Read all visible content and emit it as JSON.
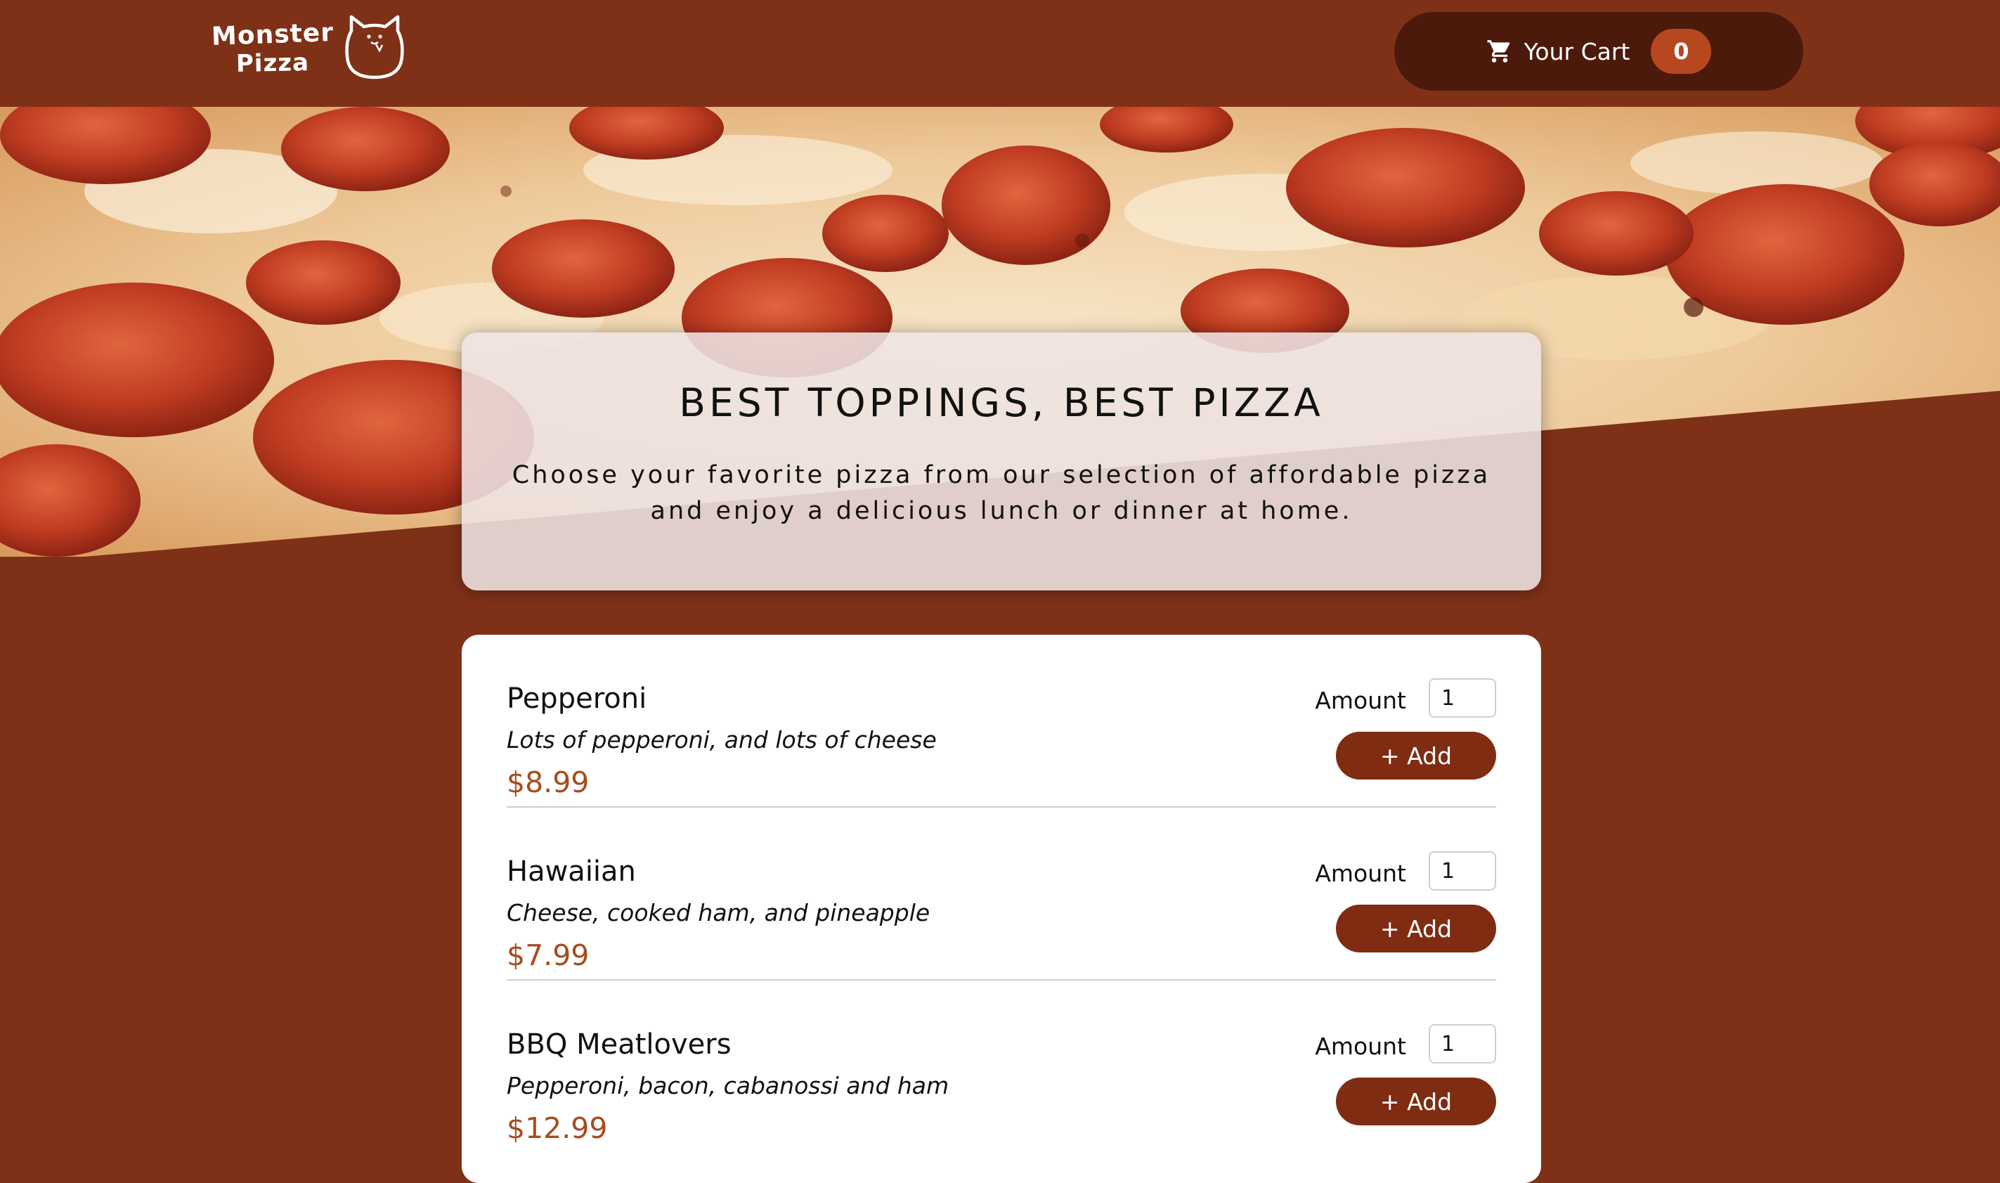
{
  "header": {
    "logo_line1": "Monster",
    "logo_line2": "Pizza",
    "cart_label": "Your Cart",
    "cart_count": "0"
  },
  "summary": {
    "title": "BEST TOPPINGS, BEST PIZZA",
    "text": "Choose your favorite pizza from our selection of affordable pizza and enjoy a delicious lunch or dinner at home."
  },
  "meals": [
    {
      "name": "Pepperoni",
      "description": "Lots of pepperoni, and lots of cheese",
      "price": "$8.99",
      "amount_label": "Amount",
      "amount_value": "1",
      "add_label": "+ Add"
    },
    {
      "name": "Hawaiian",
      "description": "Cheese, cooked ham, and pineapple",
      "price": "$7.99",
      "amount_label": "Amount",
      "amount_value": "1",
      "add_label": "+ Add"
    },
    {
      "name": "BBQ Meatlovers",
      "description": "Pepperoni, bacon, cabanossi and ham",
      "price": "$12.99",
      "amount_label": "Amount",
      "amount_value": "1",
      "add_label": "+ Add"
    }
  ],
  "colors": {
    "background": "#7f3117",
    "cart_button": "#4c1a0b",
    "cart_badge": "#b7471f",
    "price": "#a54d1c",
    "add_button": "#7f2c12"
  },
  "icons": {
    "cart": "shopping-cart-icon",
    "logo": "cat-logo-icon"
  }
}
